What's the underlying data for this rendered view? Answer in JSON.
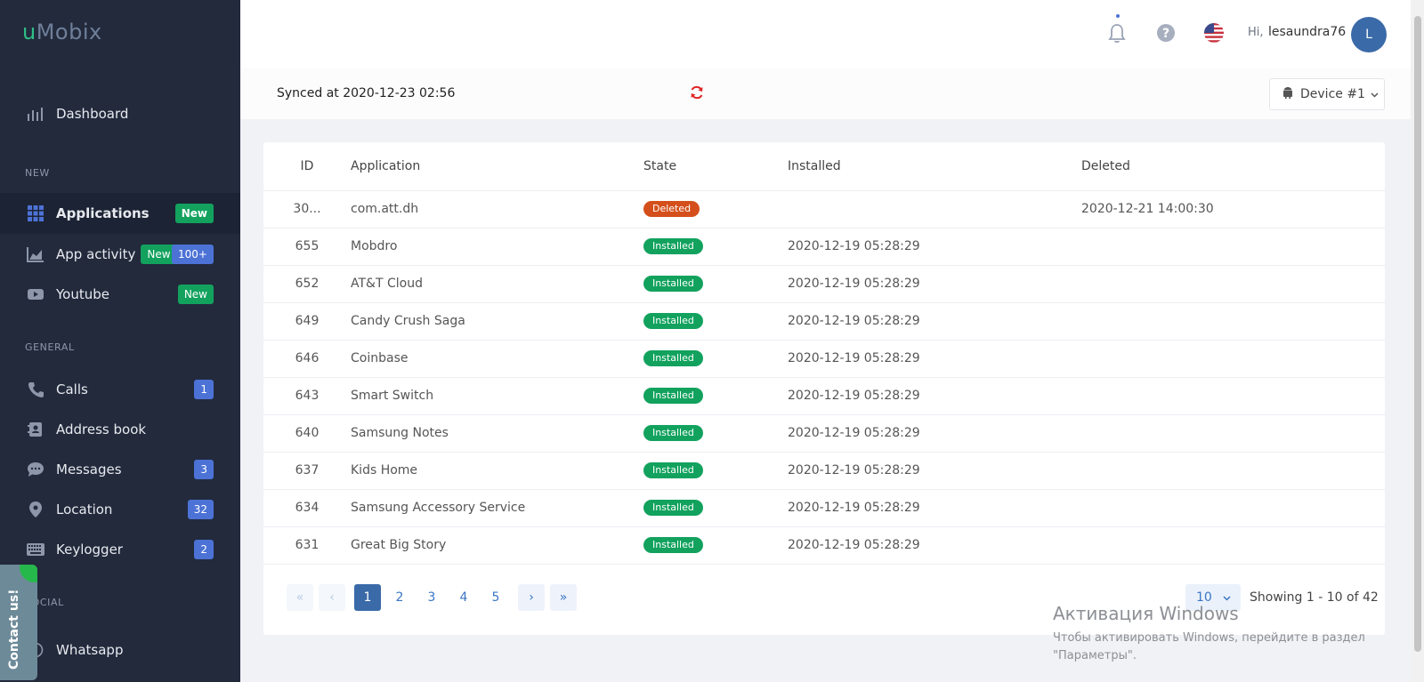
{
  "app": {
    "logo_prefix": "u",
    "logo_rest": "Mobix"
  },
  "sidebar": {
    "dashboard": "Dashboard",
    "section_new": "NEW",
    "applications": {
      "label": "Applications",
      "badge": "New"
    },
    "app_activity": {
      "label": "App activity",
      "badge": "New",
      "badge2": "100+"
    },
    "youtube": {
      "label": "Youtube",
      "badge": "New"
    },
    "section_general": "GENERAL",
    "calls": {
      "label": "Calls",
      "badge": "1"
    },
    "address_book": {
      "label": "Address book"
    },
    "messages": {
      "label": "Messages",
      "badge": "3"
    },
    "location": {
      "label": "Location",
      "badge": "32"
    },
    "keylogger": {
      "label": "Keylogger",
      "badge": "2"
    },
    "section_social": "SOCIAL",
    "whatsapp": {
      "label": "Whatsapp"
    },
    "contact_us": "Contact us!"
  },
  "header": {
    "greeting": "Hi,",
    "username": "lesaundra76",
    "avatar_initial": "L"
  },
  "sync": {
    "text": "Synced at 2020-12-23 02:56"
  },
  "device": {
    "label": "Device #1"
  },
  "table": {
    "columns": [
      "ID",
      "Application",
      "State",
      "Installed",
      "Deleted"
    ],
    "rows": [
      {
        "id": "30...",
        "app": "com.att.dh",
        "state": "Deleted",
        "installed": "",
        "deleted": "2020-12-21 14:00:30"
      },
      {
        "id": "655",
        "app": "Mobdro",
        "state": "Installed",
        "installed": "2020-12-19 05:28:29",
        "deleted": ""
      },
      {
        "id": "652",
        "app": "AT&T Cloud",
        "state": "Installed",
        "installed": "2020-12-19 05:28:29",
        "deleted": ""
      },
      {
        "id": "649",
        "app": "Candy Crush Saga",
        "state": "Installed",
        "installed": "2020-12-19 05:28:29",
        "deleted": ""
      },
      {
        "id": "646",
        "app": "Coinbase",
        "state": "Installed",
        "installed": "2020-12-19 05:28:29",
        "deleted": ""
      },
      {
        "id": "643",
        "app": "Smart Switch",
        "state": "Installed",
        "installed": "2020-12-19 05:28:29",
        "deleted": ""
      },
      {
        "id": "640",
        "app": "Samsung Notes",
        "state": "Installed",
        "installed": "2020-12-19 05:28:29",
        "deleted": ""
      },
      {
        "id": "637",
        "app": "Kids Home",
        "state": "Installed",
        "installed": "2020-12-19 05:28:29",
        "deleted": ""
      },
      {
        "id": "634",
        "app": "Samsung Accessory Service",
        "state": "Installed",
        "installed": "2020-12-19 05:28:29",
        "deleted": ""
      },
      {
        "id": "631",
        "app": "Great Big Story",
        "state": "Installed",
        "installed": "2020-12-19 05:28:29",
        "deleted": ""
      }
    ]
  },
  "pagination": {
    "first": "«",
    "prev": "‹",
    "next": "›",
    "last": "»",
    "pages": [
      "1",
      "2",
      "3",
      "4",
      "5"
    ],
    "current": "1",
    "per_page": "10",
    "showing": "Showing 1 - 10 of 42"
  },
  "watermark": {
    "line1": "Активация Windows",
    "line2": "Чтобы активировать Windows, перейдите в раздел",
    "line3": "\"Параметры\"."
  },
  "colors": {
    "sidebar_bg": "#222a3c",
    "accent_green": "#12a25e",
    "badge_blue": "#4c72d6",
    "deleted_orange": "#d44f1b",
    "primary_blue": "#3a6aa8"
  },
  "icons": {
    "dashboard": "chart-bars-icon",
    "applications": "grid-icon",
    "app_activity": "area-chart-icon",
    "youtube": "video-icon",
    "calls": "phone-icon",
    "address_book": "contact-book-icon",
    "messages": "chat-bubble-icon",
    "location": "map-pin-icon",
    "keylogger": "keyboard-icon",
    "whatsapp": "whatsapp-icon",
    "bell": "bell-icon",
    "help": "question-circle-icon",
    "flag": "us-flag-icon",
    "sync": "refresh-icon",
    "device": "android-icon"
  }
}
